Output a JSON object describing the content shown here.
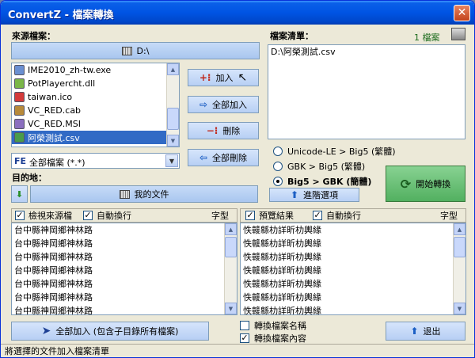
{
  "window": {
    "title": "ConvertZ - 檔案轉換",
    "close_glyph": "✕"
  },
  "source": {
    "label": "來源檔案：",
    "path": "D:\\",
    "files": [
      {
        "name": "IME2010_zh-tw.exe",
        "icon": "installer-icon"
      },
      {
        "name": "PotPlayercht.dll",
        "icon": "dll-icon"
      },
      {
        "name": "taiwan.ico",
        "icon": "flag-icon"
      },
      {
        "name": "VC_RED.cab",
        "icon": "cabinet-icon"
      },
      {
        "name": "VC_RED.MSI",
        "icon": "msi-icon"
      },
      {
        "name": "阿榮測試.csv",
        "icon": "csv-icon",
        "selected": true
      }
    ],
    "filter_prefix": "FE",
    "filter_value": "全部檔案 (*.*)"
  },
  "buttons": {
    "add": "加入",
    "add_all": "全部加入",
    "remove": "刪除",
    "remove_all": "全部刪除",
    "add_all_sub": "全部加入 (包含子目錄所有檔案)",
    "start": "開始轉換",
    "advanced": "進階選項",
    "exit": "退出"
  },
  "file_list": {
    "label": "檔案清單：",
    "count": "1 檔案",
    "items": [
      "D:\\阿榮測試.csv"
    ]
  },
  "conversion_options": [
    {
      "label": "Unicode-LE > Big5 (繁體)",
      "selected": false
    },
    {
      "label": "GBK > Big5 (繁體)",
      "selected": false
    },
    {
      "label": "Big5 > GBK (簡體)",
      "selected": true
    }
  ],
  "destination": {
    "label": "目的地：",
    "path": "我的文件"
  },
  "left_pane": {
    "view_source_label": "檢視來源檔",
    "wrap_label": "自動換行",
    "font_label": "字型",
    "lines": [
      "台中縣神岡鄉神林路",
      "台中縣神岡鄉神林路",
      "台中縣神岡鄉神林路",
      "台中縣神岡鄉神林路",
      "台中縣神岡鄉神林路",
      "台中縣神岡鄉神林路",
      "台中縣神岡鄉神林路"
    ]
  },
  "right_pane": {
    "preview_label": "預覽結果",
    "wrap_label": "自動換行",
    "font_label": "字型",
    "lines": [
      "怢竷緜朸詳昕朸輿緣",
      "怢竷緜朸詳昕朸輿緣",
      "怢竷緜朸詳昕朸輿緣",
      "怢竷緜朸詳昕朸輿緣",
      "怢竷緜朸詳昕朸輿緣",
      "怢竷緜朸詳昕朸輿緣",
      "怢竷緜朸詳昕朸輿緣"
    ]
  },
  "bottom_options": [
    {
      "label": "轉換檔案名稱",
      "checked": false
    },
    {
      "label": "轉換檔案內容",
      "checked": true
    }
  ],
  "status": "將選擇的文件加入檔案清單"
}
